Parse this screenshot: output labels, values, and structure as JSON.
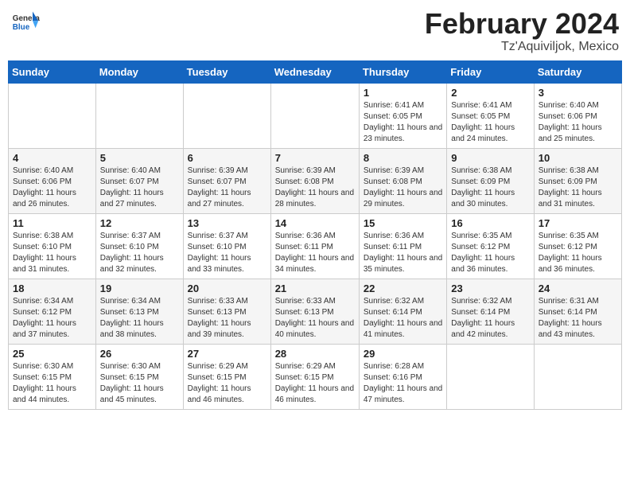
{
  "header": {
    "logo": {
      "general": "General",
      "blue": "Blue"
    },
    "title": "February 2024",
    "subtitle": "Tz'Aquiviljok, Mexico"
  },
  "calendar": {
    "days_of_week": [
      "Sunday",
      "Monday",
      "Tuesday",
      "Wednesday",
      "Thursday",
      "Friday",
      "Saturday"
    ],
    "weeks": [
      [
        {
          "day": "",
          "info": ""
        },
        {
          "day": "",
          "info": ""
        },
        {
          "day": "",
          "info": ""
        },
        {
          "day": "",
          "info": ""
        },
        {
          "day": "1",
          "info": "Sunrise: 6:41 AM\nSunset: 6:05 PM\nDaylight: 11 hours and 23 minutes."
        },
        {
          "day": "2",
          "info": "Sunrise: 6:41 AM\nSunset: 6:05 PM\nDaylight: 11 hours and 24 minutes."
        },
        {
          "day": "3",
          "info": "Sunrise: 6:40 AM\nSunset: 6:06 PM\nDaylight: 11 hours and 25 minutes."
        }
      ],
      [
        {
          "day": "4",
          "info": "Sunrise: 6:40 AM\nSunset: 6:06 PM\nDaylight: 11 hours and 26 minutes."
        },
        {
          "day": "5",
          "info": "Sunrise: 6:40 AM\nSunset: 6:07 PM\nDaylight: 11 hours and 27 minutes."
        },
        {
          "day": "6",
          "info": "Sunrise: 6:39 AM\nSunset: 6:07 PM\nDaylight: 11 hours and 27 minutes."
        },
        {
          "day": "7",
          "info": "Sunrise: 6:39 AM\nSunset: 6:08 PM\nDaylight: 11 hours and 28 minutes."
        },
        {
          "day": "8",
          "info": "Sunrise: 6:39 AM\nSunset: 6:08 PM\nDaylight: 11 hours and 29 minutes."
        },
        {
          "day": "9",
          "info": "Sunrise: 6:38 AM\nSunset: 6:09 PM\nDaylight: 11 hours and 30 minutes."
        },
        {
          "day": "10",
          "info": "Sunrise: 6:38 AM\nSunset: 6:09 PM\nDaylight: 11 hours and 31 minutes."
        }
      ],
      [
        {
          "day": "11",
          "info": "Sunrise: 6:38 AM\nSunset: 6:10 PM\nDaylight: 11 hours and 31 minutes."
        },
        {
          "day": "12",
          "info": "Sunrise: 6:37 AM\nSunset: 6:10 PM\nDaylight: 11 hours and 32 minutes."
        },
        {
          "day": "13",
          "info": "Sunrise: 6:37 AM\nSunset: 6:10 PM\nDaylight: 11 hours and 33 minutes."
        },
        {
          "day": "14",
          "info": "Sunrise: 6:36 AM\nSunset: 6:11 PM\nDaylight: 11 hours and 34 minutes."
        },
        {
          "day": "15",
          "info": "Sunrise: 6:36 AM\nSunset: 6:11 PM\nDaylight: 11 hours and 35 minutes."
        },
        {
          "day": "16",
          "info": "Sunrise: 6:35 AM\nSunset: 6:12 PM\nDaylight: 11 hours and 36 minutes."
        },
        {
          "day": "17",
          "info": "Sunrise: 6:35 AM\nSunset: 6:12 PM\nDaylight: 11 hours and 36 minutes."
        }
      ],
      [
        {
          "day": "18",
          "info": "Sunrise: 6:34 AM\nSunset: 6:12 PM\nDaylight: 11 hours and 37 minutes."
        },
        {
          "day": "19",
          "info": "Sunrise: 6:34 AM\nSunset: 6:13 PM\nDaylight: 11 hours and 38 minutes."
        },
        {
          "day": "20",
          "info": "Sunrise: 6:33 AM\nSunset: 6:13 PM\nDaylight: 11 hours and 39 minutes."
        },
        {
          "day": "21",
          "info": "Sunrise: 6:33 AM\nSunset: 6:13 PM\nDaylight: 11 hours and 40 minutes."
        },
        {
          "day": "22",
          "info": "Sunrise: 6:32 AM\nSunset: 6:14 PM\nDaylight: 11 hours and 41 minutes."
        },
        {
          "day": "23",
          "info": "Sunrise: 6:32 AM\nSunset: 6:14 PM\nDaylight: 11 hours and 42 minutes."
        },
        {
          "day": "24",
          "info": "Sunrise: 6:31 AM\nSunset: 6:14 PM\nDaylight: 11 hours and 43 minutes."
        }
      ],
      [
        {
          "day": "25",
          "info": "Sunrise: 6:30 AM\nSunset: 6:15 PM\nDaylight: 11 hours and 44 minutes."
        },
        {
          "day": "26",
          "info": "Sunrise: 6:30 AM\nSunset: 6:15 PM\nDaylight: 11 hours and 45 minutes."
        },
        {
          "day": "27",
          "info": "Sunrise: 6:29 AM\nSunset: 6:15 PM\nDaylight: 11 hours and 46 minutes."
        },
        {
          "day": "28",
          "info": "Sunrise: 6:29 AM\nSunset: 6:15 PM\nDaylight: 11 hours and 46 minutes."
        },
        {
          "day": "29",
          "info": "Sunrise: 6:28 AM\nSunset: 6:16 PM\nDaylight: 11 hours and 47 minutes."
        },
        {
          "day": "",
          "info": ""
        },
        {
          "day": "",
          "info": ""
        }
      ]
    ]
  }
}
